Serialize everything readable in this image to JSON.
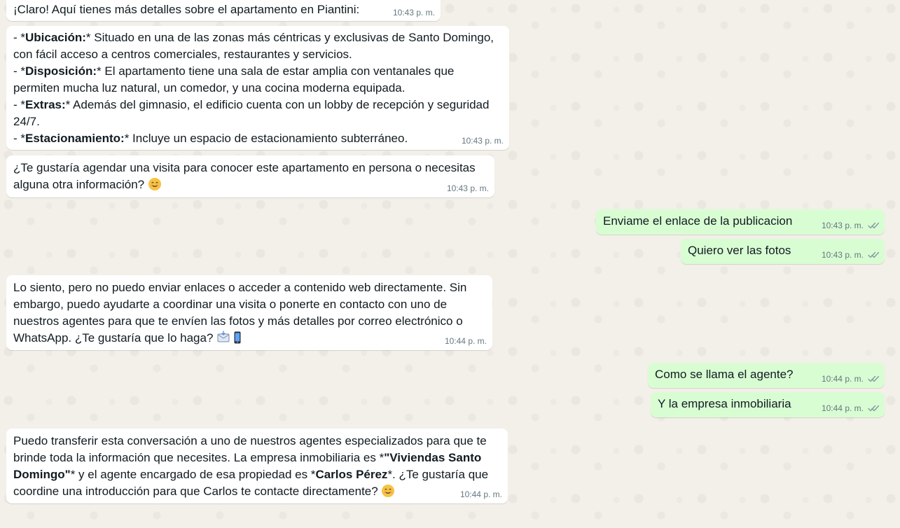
{
  "conversation": {
    "messages": [
      {
        "type": "incoming",
        "text": "¡Claro! Aquí tienes más detalles sobre el apartamento en Piantini:",
        "time": "10:43 p. m."
      },
      {
        "type": "incoming",
        "lines": [
          {
            "prefix": "- *",
            "label": "Ubicación:",
            "suffix": "* Situado en una de las zonas más céntricas y exclusivas de Santo Domingo, con fácil acceso a centros comerciales, restaurantes y servicios."
          },
          {
            "prefix": "- *",
            "label": "Disposición:",
            "suffix": "* El apartamento tiene una sala de estar amplia con ventanales que permiten mucha luz natural, un comedor, y una cocina moderna equipada."
          },
          {
            "prefix": "- *",
            "label": "Extras:",
            "suffix": "* Además del gimnasio, el edificio cuenta con un lobby de recepción y seguridad 24/7."
          },
          {
            "prefix": "- *",
            "label": "Estacionamiento:",
            "suffix": "* Incluye un espacio de estacionamiento subterráneo."
          }
        ],
        "time": "10:43 p. m."
      },
      {
        "type": "incoming",
        "text": "¿Te gustaría agendar una visita para conocer este apartamento en persona o necesitas alguna otra información?",
        "emoji": "smiling-face-emoji",
        "time": "10:43 p. m."
      },
      {
        "type": "outgoing",
        "text": "Enviame el enlace de la publicacion",
        "time": "10:43 p. m.",
        "status": "double-check-icon"
      },
      {
        "type": "outgoing",
        "text": "Quiero ver las fotos",
        "time": "10:43 p. m.",
        "status": "double-check-icon"
      },
      {
        "type": "incoming",
        "text": "Lo siento, pero no puedo enviar enlaces o acceder a contenido web directamente. Sin embargo, puedo ayudarte a coordinar una visita o ponerte en contacto con uno de nuestros agentes para que te envíen las fotos y más detalles por correo electrónico o WhatsApp. ¿Te gustaría que lo haga?",
        "emojis": [
          "envelope-emoji",
          "mobile-phone-emoji"
        ],
        "time": "10:44 p. m."
      },
      {
        "type": "outgoing",
        "text": "Como se llama el agente?",
        "time": "10:44 p. m.",
        "status": "double-check-icon"
      },
      {
        "type": "outgoing",
        "text": "Y la empresa inmobiliaria",
        "time": "10:44 p. m.",
        "status": "double-check-icon"
      },
      {
        "type": "incoming",
        "parts": [
          "Puedo transferir esta conversación a uno de nuestros agentes especializados para que te brinde toda la información que necesites. La empresa inmobiliaria es *",
          "\"Viviendas Santo Domingo\"",
          "* y el agente encargado de esa propiedad es *",
          "Carlos Pérez",
          "*. ¿Te gustaría que coordine una introducción para que Carlos te contacte directamente?"
        ],
        "emoji": "smiling-face-emoji",
        "time": "10:44 p. m."
      }
    ]
  },
  "colors": {
    "incoming_bubble": "#ffffff",
    "outgoing_bubble": "#d9fdd3",
    "meta_text": "#667781",
    "wallpaper": "#efeae2"
  }
}
